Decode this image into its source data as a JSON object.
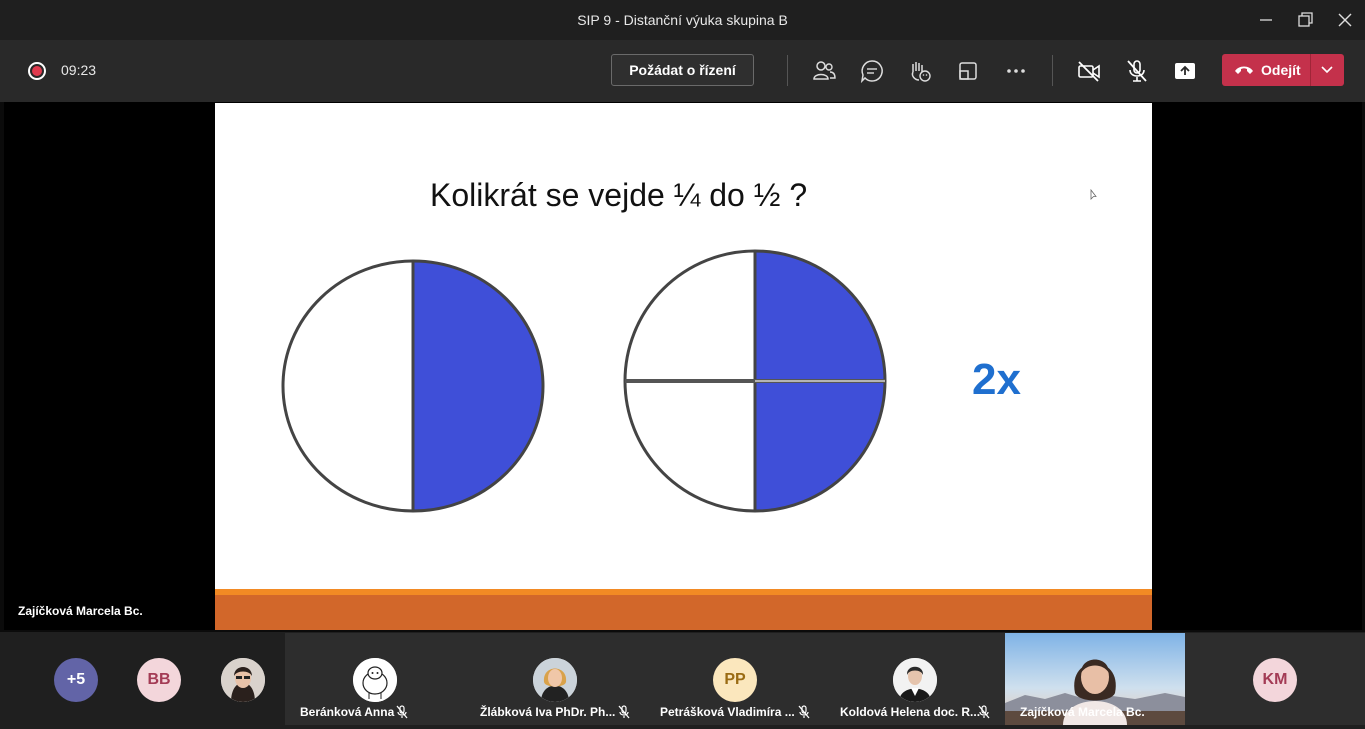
{
  "window": {
    "title": "SIP 9 - Distanční výuka skupina B"
  },
  "toolbar": {
    "timer": "09:23",
    "request_control_label": "Požádat o řízení",
    "leave_label": "Odejít"
  },
  "slide": {
    "question": "Kolikrát se vejde ¼ do ½ ?",
    "answer": "2x",
    "fill_color": "#3f4fd8"
  },
  "stage": {
    "speaker_name": "Zajíčková Marcela Bc."
  },
  "participants": {
    "overflow_count": "+5",
    "bb_initials": "BB",
    "pp_initials": "PP",
    "km_initials": "KM",
    "tiles": [
      {
        "name": "Beránková Anna"
      },
      {
        "name": "Žlábková Iva PhDr. Ph..."
      },
      {
        "name": "Petrášková Vladimíra ..."
      },
      {
        "name": "Koldová Helena doc. R..."
      },
      {
        "name": "Zajíčková Marcela Bc."
      }
    ]
  }
}
